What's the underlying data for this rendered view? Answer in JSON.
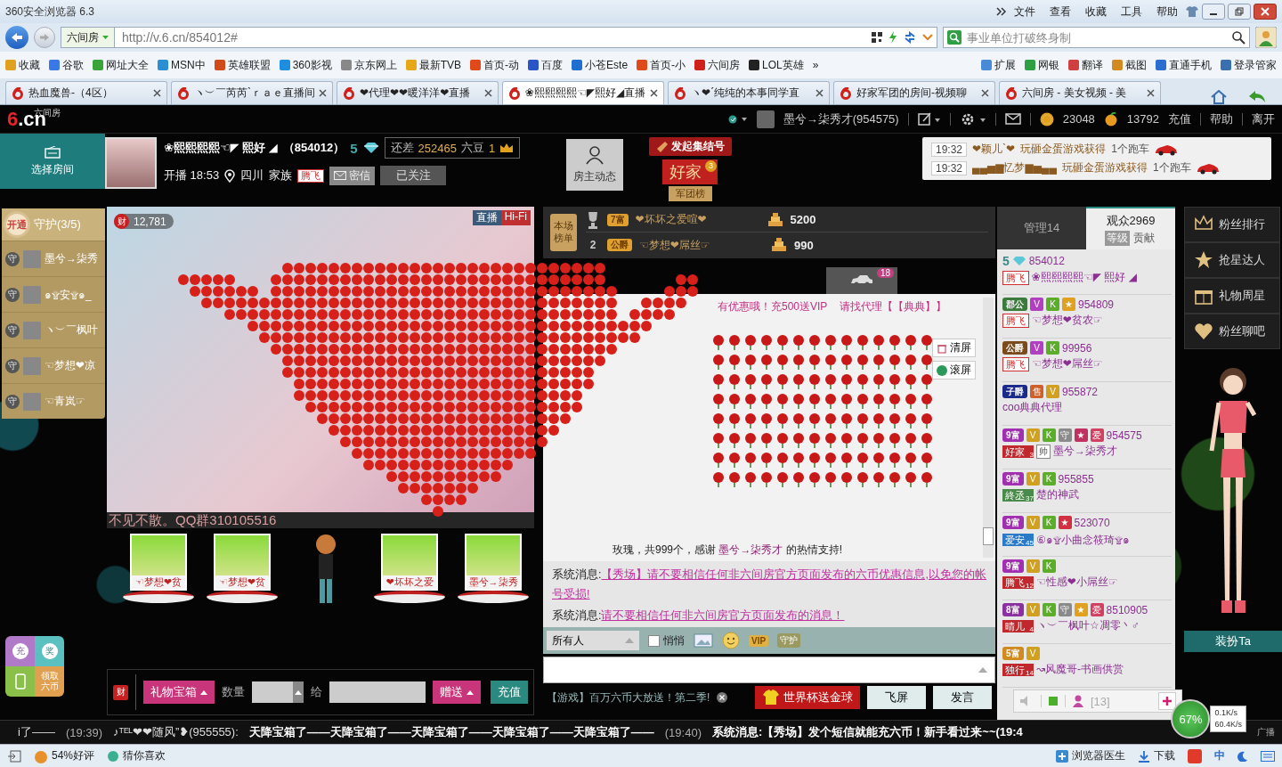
{
  "window": {
    "title": "360安全浏览器 6.3",
    "menu": [
      "文件",
      "查看",
      "收藏",
      "工具",
      "帮助"
    ]
  },
  "address_bar": {
    "site": "六间房",
    "url": "http://v.6.cn/854012#",
    "placeholder": "事业单位打破终身制"
  },
  "bookmarks": [
    {
      "label": "收藏",
      "color": "#e0a020"
    },
    {
      "label": "谷歌",
      "color": "#3b78e7"
    },
    {
      "label": "网址大全",
      "color": "#3aa33a"
    },
    {
      "label": "MSN中",
      "color": "#2b8fd6"
    },
    {
      "label": "英雄联盟",
      "color": "#d04a1a"
    },
    {
      "label": "360影视",
      "color": "#1e8fe0"
    },
    {
      "label": "京东网上",
      "color": "#888888"
    },
    {
      "label": "最新TVB",
      "color": "#e6a817"
    },
    {
      "label": "首页-动",
      "color": "#e04a1a"
    },
    {
      "label": "百度",
      "color": "#2a55c8"
    },
    {
      "label": "小苍Este",
      "color": "#1e6fd0"
    },
    {
      "label": "首页-小",
      "color": "#e04a1a"
    },
    {
      "label": "六间房",
      "color": "#d0201a"
    },
    {
      "label": "LOL英雄",
      "color": "#222222"
    }
  ],
  "bookmark_more": "»",
  "toolbar_items": [
    {
      "label": "扩展",
      "color": "#4a8ad6"
    },
    {
      "label": "网银",
      "color": "#2ea043"
    },
    {
      "label": "翻译",
      "color": "#d04040"
    },
    {
      "label": "截图",
      "color": "#d08a20"
    },
    {
      "label": "直通手机",
      "color": "#2a6fd0"
    },
    {
      "label": "登录管家",
      "color": "#3a6fb0"
    }
  ],
  "tabs": [
    {
      "label": "热血魔兽-（4区）",
      "selected": false
    },
    {
      "label": "ヽ︶￣芮芮ˋｒａｅ直播间",
      "selected": false
    },
    {
      "label": "❤代理❤❤暖洋洋❤直播",
      "selected": false
    },
    {
      "label": "❀熙熙熙熙☜◤熙好◢直播",
      "selected": true
    },
    {
      "label": "ヽ❤ˊ纯纯的本事同学直",
      "selected": false
    },
    {
      "label": "好家军团的房间-视频聊",
      "selected": false
    },
    {
      "label": "六间房 - 美女视频 - 美",
      "selected": false
    }
  ],
  "site_header": {
    "logo_mark": "6",
    "logo_text": ".cn",
    "logo_sub": "六间房",
    "user": "墨兮→柒秀才(954575)",
    "coins": "23048",
    "beans": "13792",
    "links": [
      "充值",
      "帮助",
      "离开"
    ]
  },
  "room_button": "选择房间",
  "host": {
    "name": "❀熙熙熙熙☜◤ 熙好 ◢",
    "room_id": "（854012）",
    "level": "5",
    "gap_label": "还差",
    "gap_value": "252465",
    "gap_unit": "六豆",
    "next_level": "1",
    "start": "开播 18:53",
    "location": "四川",
    "family_label": "家族",
    "family_badge": "腾飞",
    "message_button": "密信",
    "follow_button": "已关注"
  },
  "host_news": "房主动态",
  "rally": "发起集结号",
  "family_flag": {
    "name": "好家",
    "count": "3",
    "label": "军团榜"
  },
  "notices": [
    {
      "time": "19:32",
      "user": "❤颖儿ˋ❤",
      "text": "玩砸金蛋游戏获得",
      "prize": "1个跑车"
    },
    {
      "time": "19:32",
      "user": "▄▄▅▆忆梦▆▅▄▄",
      "text": "玩砸金蛋游戏获得",
      "prize": "1个跑车"
    }
  ],
  "guard": {
    "open": "开通",
    "title": "守护(3/5)",
    "members": [
      {
        "mark": "守",
        "name": "墨兮→柒秀"
      },
      {
        "mark": "守",
        "name": "๑۩安۩๑_"
      },
      {
        "mark": "守",
        "name": "ヽ︶￣枫叶"
      },
      {
        "mark": "守",
        "name": "☜梦想❤凉"
      },
      {
        "mark": "守",
        "name": "☜青岚☞"
      }
    ]
  },
  "video": {
    "wealth_mark": "财",
    "wealth": "12,781",
    "live": "直播",
    "hifi": "Hi-Fi",
    "caption": "不见不散。QQ群310105516"
  },
  "seats": [
    {
      "kind": "card",
      "label": "☜梦想❤贫"
    },
    {
      "kind": "card",
      "label": "☜梦想❤贫"
    },
    {
      "kind": "figure"
    },
    {
      "kind": "card",
      "label": "❤坏坏之爱"
    },
    {
      "kind": "card",
      "label": "墨兮→柒秀"
    }
  ],
  "gift_bar": {
    "wealth_mark": "财",
    "box": "礼物宝箱",
    "qty_label": "数量",
    "to_label": "给",
    "give": "赠送",
    "recharge": "充值"
  },
  "side_widget": {
    "recharge": "充",
    "prize": "奖",
    "claim": "领取六币"
  },
  "ranking": {
    "label": "本场榜单",
    "rows": [
      {
        "kind": "trophy",
        "badge": "7富",
        "name": "❤坏坏之爱喧❤",
        "amount": "5200"
      },
      {
        "kind": "number",
        "rank": "2",
        "badge": "公爵",
        "name": "☜梦想❤屌丝☞",
        "amount": "990"
      }
    ]
  },
  "chat_tabs": {
    "car_count": "18"
  },
  "chat": {
    "promo": [
      "有优惠哦！充500送VIP",
      "请找代理【【典典】】"
    ],
    "clear": "清屏",
    "scroll": "滚屏",
    "scroll_on": true,
    "gift_text": "玫瑰，共999个，感谢",
    "gift_user": "墨兮→柒秀才",
    "gift_suffix": "的热情支持!"
  },
  "system_messages": [
    {
      "label": "系统消息:",
      "text": "【秀场】请不要相信任何非六间房官方页面发布的六币优惠信息,以免您的帐号受损!"
    },
    {
      "label": "系统消息:",
      "text": "请不要相信任何非六间房官方页面发布的消息！"
    }
  ],
  "chat_input": {
    "recipient": "所有人",
    "whisper_label": "悄悄",
    "whisper": false,
    "vip": "VIP",
    "guard": "守护"
  },
  "chat_footer": {
    "game": "【游戏】百万六币大放送！第二季!",
    "worldcup": "世界杯送金球",
    "fly": "飞屏",
    "send": "发言"
  },
  "audience": {
    "tabs": [
      {
        "label": "管理14",
        "selected": false
      },
      {
        "label": "观众2969",
        "selected": true
      }
    ],
    "sort": [
      {
        "label": "等级",
        "selected": true
      },
      {
        "label": "贡献",
        "selected": false
      }
    ],
    "users": [
      {
        "rank": {
          "kind": "diamond",
          "text": "5"
        },
        "id": "854012",
        "family": {
          "kind": "outline",
          "text": "腾飞"
        },
        "name": "❀熙熙熙熙☜◤ 熙好 ◢"
      },
      {
        "rank": {
          "kind": "title",
          "text": "郡公",
          "color": "#3a7a3a"
        },
        "badges": [
          {
            "text": "V",
            "color": "#b040c0"
          },
          {
            "text": "K",
            "color": "#5cae2a"
          },
          {
            "text": "★",
            "color": "#e0a020"
          }
        ],
        "id": "954809",
        "family": {
          "kind": "outline",
          "text": "腾飞"
        },
        "name": "☜梦想❤贫农☞"
      },
      {
        "rank": {
          "kind": "title",
          "text": "公爵",
          "color": "#7a4a1a"
        },
        "badges": [
          {
            "text": "V",
            "color": "#b040c0"
          },
          {
            "text": "K",
            "color": "#5cae2a"
          }
        ],
        "id": "99956",
        "family": {
          "kind": "outline",
          "text": "腾飞"
        },
        "name": "☜梦想❤屌丝☞"
      },
      {
        "rank": {
          "kind": "title",
          "text": "子爵",
          "color": "#1a2a8a"
        },
        "badges": [
          {
            "text": "售",
            "color": "#d0602a"
          },
          {
            "text": "V",
            "color": "#d0a020"
          }
        ],
        "id": "955872",
        "name": "coo典典代理"
      },
      {
        "rank": {
          "kind": "title",
          "text": "9富",
          "color": "#a030b0"
        },
        "badges": [
          {
            "text": "V",
            "color": "#d0a020"
          },
          {
            "text": "K",
            "color": "#5cae2a"
          },
          {
            "text": "守",
            "color": "#8a8a8a"
          },
          {
            "text": "★",
            "color": "#c03060"
          },
          {
            "text": "爱",
            "color": "#d04060"
          }
        ],
        "id": "954575",
        "family": {
          "kind": "filled",
          "text": "好家",
          "num": "3",
          "color": "#c0282d"
        },
        "tag": "帅",
        "name": "墨兮→柒秀才"
      },
      {
        "rank": {
          "kind": "title",
          "text": "9富",
          "color": "#a030b0"
        },
        "badges": [
          {
            "text": "V",
            "color": "#d0a020"
          },
          {
            "text": "K",
            "color": "#5cae2a"
          }
        ],
        "id": "955855",
        "family": {
          "kind": "filled",
          "text": "終丞",
          "num": "37",
          "color": "#4a8a4a"
        },
        "name": "楚的神武"
      },
      {
        "rank": {
          "kind": "title",
          "text": "9富",
          "color": "#a030b0"
        },
        "badges": [
          {
            "text": "V",
            "color": "#d0a020"
          },
          {
            "text": "K",
            "color": "#5cae2a"
          },
          {
            "text": "★",
            "color": "#d03040"
          }
        ],
        "id": "523070",
        "family": {
          "kind": "filled",
          "text": "爱安",
          "num": "45",
          "color": "#2a7ac8"
        },
        "name": "⑥๑۩小曲念筱琦۩๑"
      },
      {
        "rank": {
          "kind": "title",
          "text": "9富",
          "color": "#a030b0"
        },
        "badges": [
          {
            "text": "V",
            "color": "#d0a020"
          },
          {
            "text": "K",
            "color": "#5cae2a"
          }
        ],
        "family": {
          "kind": "filled",
          "text": "腾飞",
          "num": "12",
          "color": "#c0282d"
        },
        "name": "☜性感❤小屌丝☞"
      },
      {
        "rank": {
          "kind": "title",
          "text": "8富",
          "color": "#8a30a0"
        },
        "badges": [
          {
            "text": "V",
            "color": "#d0a020"
          },
          {
            "text": "K",
            "color": "#5cae2a"
          },
          {
            "text": "守",
            "color": "#8a8a8a"
          },
          {
            "text": "★",
            "color": "#e0a020"
          },
          {
            "text": "爱",
            "color": "#d04060"
          }
        ],
        "id": "8510905",
        "family": {
          "kind": "filled",
          "text": "晴儿",
          "num": "4",
          "color": "#c0282d"
        },
        "name": "ヽ︶￣枫叶☆凋零丶♂"
      },
      {
        "rank": {
          "kind": "title",
          "text": "5富",
          "color": "#d08a20"
        },
        "badges": [
          {
            "text": "V",
            "color": "#d0a020"
          }
        ],
        "family": {
          "kind": "filled",
          "text": "独行",
          "num": "14",
          "color": "#c0282d"
        },
        "name": "↝风魔哥-书画供赏"
      }
    ],
    "online": "[13]"
  },
  "side_menu": [
    "粉丝排行",
    "抢星达人",
    "礼物周星",
    "粉丝聊吧"
  ],
  "dress_up": "装扮Ta",
  "ticker": [
    {
      "text": "i了——"
    },
    {
      "text": "(19:39)",
      "kind": "time"
    },
    {
      "text": "♪ᵀᴱᴸ❤❤随风”❥(955555):",
      "kind": "user"
    },
    {
      "text": "天降宝箱了——天降宝箱了——天降宝箱了——天降宝箱了——天降宝箱了——",
      "kind": "bold"
    },
    {
      "text": "(19:40)",
      "kind": "time"
    },
    {
      "text": "系统消息:【秀场】发个短信就能充六币！新手看过来~~(19:4",
      "kind": "bold"
    }
  ],
  "ticker_end": "广播",
  "speed": {
    "percent": "67%",
    "up": "0.1K/s",
    "down": "60.4K/s"
  },
  "status_bar": {
    "rating": "54%好评",
    "guess": "猜你喜欢",
    "doctor": "浏览器医生",
    "download": "下载",
    "ime": "中"
  }
}
